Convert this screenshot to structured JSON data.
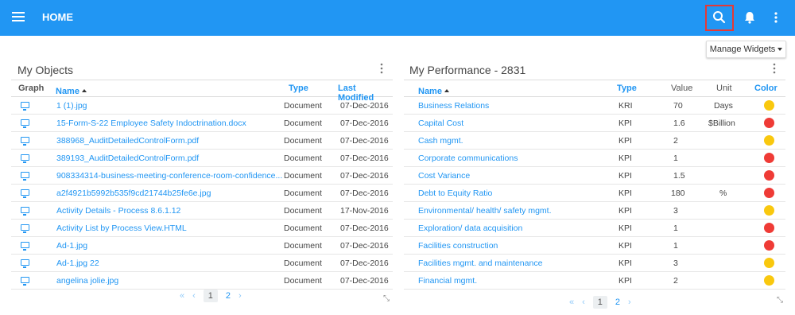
{
  "header": {
    "title": "HOME",
    "brand_color": "#2196f3"
  },
  "toolbar": {
    "manage_widgets": "Manage Widgets"
  },
  "objects": {
    "title": "My Objects",
    "columns": {
      "graph": "Graph",
      "name": "Name",
      "type": "Type",
      "modified": "Last Modified"
    },
    "rows": [
      {
        "name": "1 (1).jpg",
        "type": "Document",
        "modified": "07-Dec-2016"
      },
      {
        "name": "15-Form-S-22 Employee Safety Indoctrination.docx",
        "type": "Document",
        "modified": "07-Dec-2016"
      },
      {
        "name": "388968_AuditDetailedControlForm.pdf",
        "type": "Document",
        "modified": "07-Dec-2016"
      },
      {
        "name": "389193_AuditDetailedControlForm.pdf",
        "type": "Document",
        "modified": "07-Dec-2016"
      },
      {
        "name": "908334314-business-meeting-conference-room-confidence...",
        "type": "Document",
        "modified": "07-Dec-2016"
      },
      {
        "name": "a2f4921b5992b535f9cd21744b25fe6e.jpg",
        "type": "Document",
        "modified": "07-Dec-2016"
      },
      {
        "name": "Activity Details - Process 8.6.1.12",
        "type": "Document",
        "modified": "17-Nov-2016"
      },
      {
        "name": "Activity List by Process View.HTML",
        "type": "Document",
        "modified": "07-Dec-2016"
      },
      {
        "name": "Ad-1.jpg",
        "type": "Document",
        "modified": "07-Dec-2016"
      },
      {
        "name": "Ad-1.jpg 22",
        "type": "Document",
        "modified": "07-Dec-2016"
      },
      {
        "name": "angelina jolie.jpg",
        "type": "Document",
        "modified": "07-Dec-2016"
      }
    ],
    "pager": {
      "first": "«",
      "prev": "‹",
      "page1": "1",
      "page2": "2",
      "next": "›"
    }
  },
  "performance": {
    "title": "My Performance - 2831",
    "columns": {
      "name": "Name",
      "type": "Type",
      "value": "Value",
      "unit": "Unit",
      "color": "Color"
    },
    "rows": [
      {
        "name": "Business Relations",
        "type": "KRI",
        "value": "70",
        "unit": "Days",
        "color": "#f9c80e"
      },
      {
        "name": "Capital Cost",
        "type": "KPI",
        "value": "1.6",
        "unit": "$Billion",
        "color": "#ef3b36"
      },
      {
        "name": "Cash mgmt.",
        "type": "KPI",
        "value": "2",
        "unit": "",
        "color": "#f9c80e"
      },
      {
        "name": "Corporate communications",
        "type": "KPI",
        "value": "1",
        "unit": "",
        "color": "#ef3b36"
      },
      {
        "name": "Cost Variance",
        "type": "KPI",
        "value": "1.5",
        "unit": "",
        "color": "#ef3b36"
      },
      {
        "name": "Debt to Equity Ratio",
        "type": "KPI",
        "value": "180",
        "unit": "%",
        "color": "#ef3b36"
      },
      {
        "name": "Environmental/ health/ safety mgmt.",
        "type": "KPI",
        "value": "3",
        "unit": "",
        "color": "#f9c80e"
      },
      {
        "name": "Exploration/ data acquisition",
        "type": "KPI",
        "value": "1",
        "unit": "",
        "color": "#ef3b36"
      },
      {
        "name": "Facilities construction",
        "type": "KPI",
        "value": "1",
        "unit": "",
        "color": "#ef3b36"
      },
      {
        "name": "Facilities mgmt. and maintenance",
        "type": "KPI",
        "value": "3",
        "unit": "",
        "color": "#f9c80e"
      },
      {
        "name": "Financial mgmt.",
        "type": "KPI",
        "value": "2",
        "unit": "",
        "color": "#f9c80e"
      }
    ],
    "pager": {
      "first": "«",
      "prev": "‹",
      "page1": "1",
      "page2": "2",
      "next": "›"
    }
  }
}
